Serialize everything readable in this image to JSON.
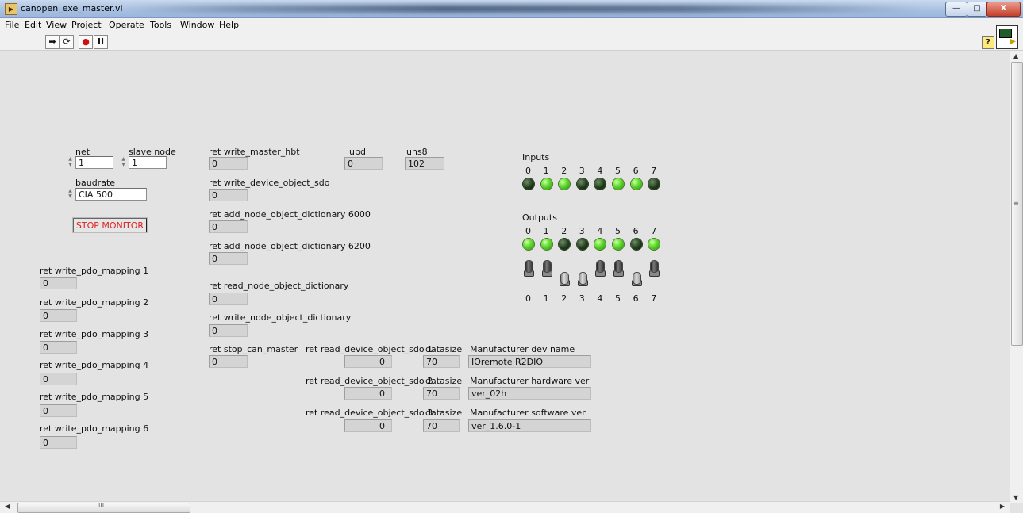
{
  "window": {
    "title": "canopen_exe_master.vi",
    "btn_min": "—",
    "btn_max": "□",
    "btn_close": "X"
  },
  "menu": [
    "File",
    "Edit",
    "View",
    "Project",
    "Operate",
    "Tools",
    "Window",
    "Help"
  ],
  "toolbar": {
    "run": "➡",
    "run_continuous": "⟳",
    "abort": "●",
    "pause": "II",
    "help": "?"
  },
  "controls": {
    "net": {
      "label": "net",
      "value": "1"
    },
    "slave_node": {
      "label": "slave node",
      "value": "1"
    },
    "baudrate": {
      "label": "baudrate",
      "value": "CIA 500"
    },
    "stop_monitor": "STOP MONITOR"
  },
  "pdo": [
    {
      "label": "ret write_pdo_mapping 1",
      "value": "0"
    },
    {
      "label": "ret write_pdo_mapping 2",
      "value": "0"
    },
    {
      "label": "ret write_pdo_mapping 3",
      "value": "0"
    },
    {
      "label": "ret write_pdo_mapping 4",
      "value": "0"
    },
    {
      "label": "ret write_pdo_mapping 5",
      "value": "0"
    },
    {
      "label": "ret write_pdo_mapping 6",
      "value": "0"
    }
  ],
  "mid": [
    {
      "label": "ret write_master_hbt",
      "value": "0"
    },
    {
      "label": "ret write_device_object_sdo",
      "value": "0"
    },
    {
      "label": "ret add_node_object_dictionary 6000",
      "value": "0"
    },
    {
      "label": "ret add_node_object_dictionary 6200",
      "value": "0"
    },
    {
      "label": "ret read_node_object_dictionary",
      "value": "0"
    },
    {
      "label": "ret write_node_object_dictionary",
      "value": "0"
    },
    {
      "label": "ret stop_can_master",
      "value": "0"
    }
  ],
  "upd": {
    "label": "upd",
    "value": "0"
  },
  "uns8": {
    "label": "uns8",
    "value": "102"
  },
  "sdo": [
    {
      "label": "ret read_device_object_sdo 1",
      "value": "0",
      "datasize_label": "datasize",
      "datasize": "70",
      "mf_label": "Manufacturer dev name",
      "mf_value": "IOremote R2DIO"
    },
    {
      "label": "ret read_device_object_sdo 2",
      "value": "0",
      "datasize_label": "datasize",
      "datasize": "70",
      "mf_label": "Manufacturer hardware ver",
      "mf_value": "ver_02h"
    },
    {
      "label": "ret read_device_object_sdo 3",
      "value": "0",
      "datasize_label": "datasize",
      "datasize": "70",
      "mf_label": "Manufacturer software ver",
      "mf_value": "ver_1.6.0-1"
    }
  ],
  "inputs": {
    "label": "Inputs",
    "indices": [
      "0",
      "1",
      "2",
      "3",
      "4",
      "5",
      "6",
      "7"
    ],
    "states": [
      false,
      true,
      true,
      false,
      false,
      true,
      true,
      false
    ]
  },
  "outputs": {
    "label": "Outputs",
    "indices": [
      "0",
      "1",
      "2",
      "3",
      "4",
      "5",
      "6",
      "7"
    ],
    "states": [
      true,
      true,
      false,
      false,
      true,
      true,
      false,
      true
    ]
  },
  "colors": {
    "led_on": "#6ce339",
    "led_off": "#1f3b1a",
    "stop_text": "#e02020",
    "panel_bg": "#e3e3e3"
  }
}
